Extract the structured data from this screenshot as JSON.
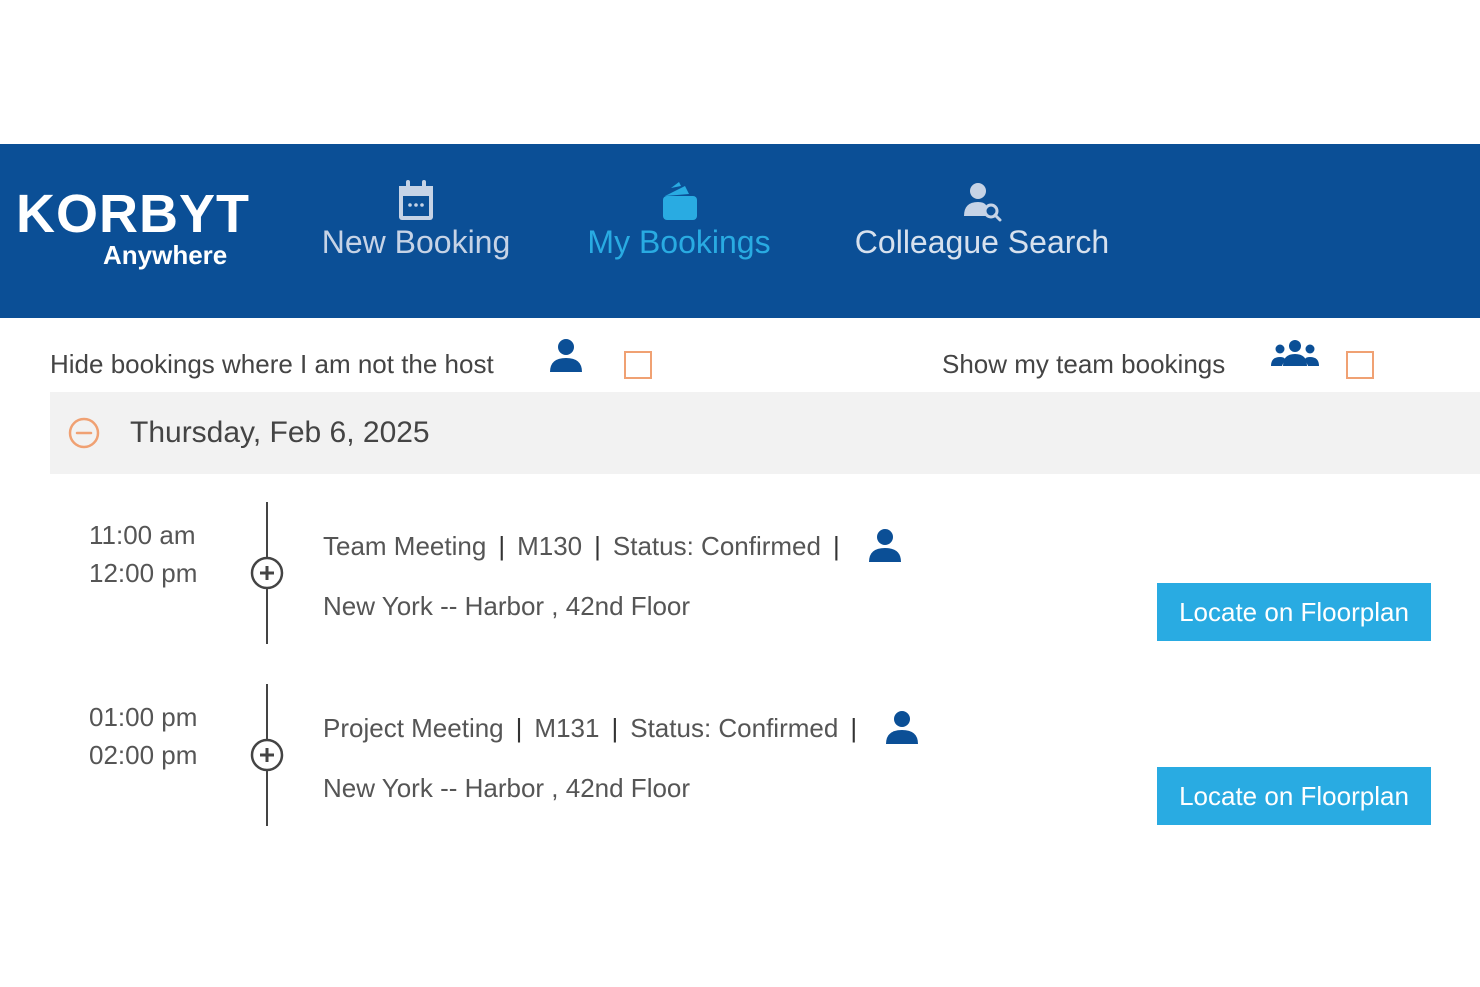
{
  "header": {
    "brand": "KORBYT",
    "brand_sub": "Anywhere",
    "nav": {
      "new_booking": "New Booking",
      "my_bookings": "My Bookings",
      "colleague_search": "Colleague Search"
    }
  },
  "filters": {
    "hide_label": "Hide bookings where I am not the host",
    "hide_checked": false,
    "team_label": "Show my team bookings",
    "team_checked": false
  },
  "day": {
    "title": "Thursday, Feb 6, 2025"
  },
  "bookings": [
    {
      "start": "11:00 am",
      "end": "12:00 pm",
      "title": "Team Meeting",
      "room": "M130",
      "status": "Status: Confirmed",
      "location": "New York -- Harbor , 42nd Floor",
      "action": "Locate on Floorplan"
    },
    {
      "start": "01:00 pm",
      "end": "02:00 pm",
      "title": "Project Meeting",
      "room": "M131",
      "status": "Status: Confirmed",
      "location": "New York -- Harbor , 42nd Floor",
      "action": "Locate on Floorplan"
    }
  ],
  "separator": "|",
  "colors": {
    "header_bg": "#0b4f96",
    "active_nav": "#29abe2",
    "button_bg": "#29abe2",
    "checkbox_border": "#f0a173",
    "icon_blue": "#0b4f96"
  }
}
